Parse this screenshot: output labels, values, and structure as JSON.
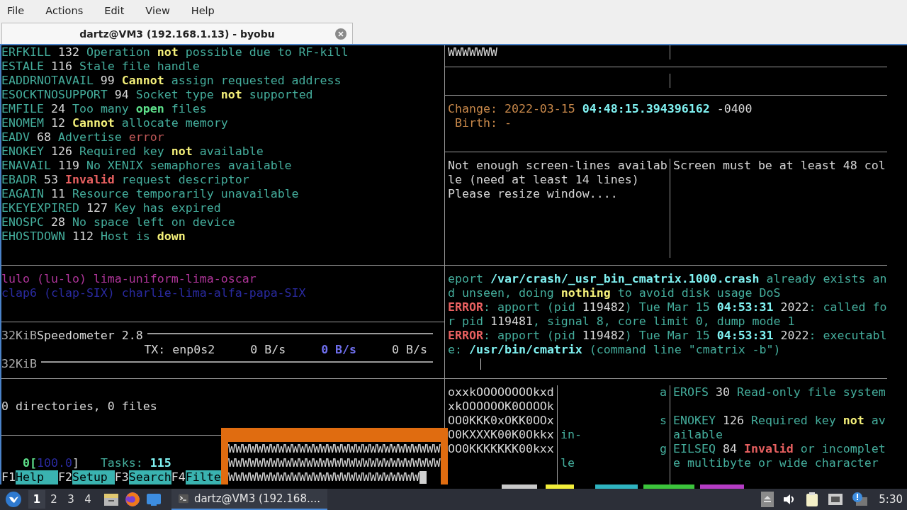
{
  "menu": [
    "File",
    "Actions",
    "Edit",
    "View",
    "Help"
  ],
  "tab": {
    "title": "dartz@VM3 (192.168.1.13) - byobu"
  },
  "errno_pane": [
    [
      {
        "text": "ERFKILL",
        "kind": "teal"
      },
      {
        "text": " 132 ",
        "kind": "light"
      },
      {
        "text": "Operation ",
        "kind": "teal"
      },
      {
        "text": "not",
        "kind": "yellow"
      },
      {
        "text": " possible due to RF-kill",
        "kind": "teal"
      }
    ],
    [
      {
        "text": "ESTALE",
        "kind": "teal"
      },
      {
        "text": " 116 ",
        "kind": "light"
      },
      {
        "text": "Stale file handle",
        "kind": "teal"
      }
    ],
    [
      {
        "text": "EADDRNOTAVAIL",
        "kind": "teal"
      },
      {
        "text": " 99 ",
        "kind": "light"
      },
      {
        "text": "Cannot",
        "kind": "yellow"
      },
      {
        "text": " assign requested address",
        "kind": "teal"
      }
    ],
    [
      {
        "text": "ESOCKTNOSUPPORT",
        "kind": "teal"
      },
      {
        "text": " 94 ",
        "kind": "light"
      },
      {
        "text": "Socket type ",
        "kind": "teal"
      },
      {
        "text": "not",
        "kind": "yellow"
      },
      {
        "text": " supported",
        "kind": "teal"
      }
    ],
    [
      {
        "text": "EMFILE",
        "kind": "teal"
      },
      {
        "text": " 24 ",
        "kind": "light"
      },
      {
        "text": "Too many ",
        "kind": "teal"
      },
      {
        "text": "open",
        "kind": "green"
      },
      {
        "text": " files",
        "kind": "teal"
      }
    ],
    [
      {
        "text": "ENOMEM",
        "kind": "teal"
      },
      {
        "text": " 12 ",
        "kind": "light"
      },
      {
        "text": "Cannot",
        "kind": "yellow"
      },
      {
        "text": " allocate memory",
        "kind": "teal"
      }
    ],
    [
      {
        "text": "EADV",
        "kind": "teal"
      },
      {
        "text": " 68 ",
        "kind": "light"
      },
      {
        "text": "Advertise ",
        "kind": "teal"
      },
      {
        "text": "error",
        "kind": "rose"
      }
    ],
    [
      {
        "text": "ENOKEY",
        "kind": "teal"
      },
      {
        "text": " 126 ",
        "kind": "light"
      },
      {
        "text": "Required key ",
        "kind": "teal"
      },
      {
        "text": "not",
        "kind": "yellow"
      },
      {
        "text": " available",
        "kind": "teal"
      }
    ],
    [
      {
        "text": "ENAVAIL",
        "kind": "teal"
      },
      {
        "text": " 119 ",
        "kind": "light"
      },
      {
        "text": "No XENIX semaphores available",
        "kind": "teal"
      }
    ],
    [
      {
        "text": "EBADR",
        "kind": "teal"
      },
      {
        "text": " 53 ",
        "kind": "light"
      },
      {
        "text": "Invalid",
        "kind": "red"
      },
      {
        "text": " request descriptor",
        "kind": "teal"
      }
    ],
    [
      {
        "text": "EAGAIN",
        "kind": "teal"
      },
      {
        "text": " 11 ",
        "kind": "light"
      },
      {
        "text": "Resource temporarily unavailable",
        "kind": "teal"
      }
    ],
    [
      {
        "text": "EKEYEXPIRED",
        "kind": "teal"
      },
      {
        "text": " 127 ",
        "kind": "light"
      },
      {
        "text": "Key has expired",
        "kind": "teal"
      }
    ],
    [
      {
        "text": "ENOSPC",
        "kind": "teal"
      },
      {
        "text": " 28 ",
        "kind": "light"
      },
      {
        "text": "No space left on device",
        "kind": "teal"
      }
    ],
    [
      {
        "text": "EHOSTDOWN",
        "kind": "teal"
      },
      {
        "text": " 112 ",
        "kind": "light"
      },
      {
        "text": "Host is ",
        "kind": "teal"
      },
      {
        "text": "down",
        "kind": "yellow"
      }
    ]
  ],
  "alphabet_pane": [
    [
      {
        "text": "lulo (lu-lo) lima-uniform-lima-oscar",
        "kind": "magenta"
      }
    ],
    [
      {
        "text": "clap6 (clap-SIX) charlie-lima-alfa-papa-SIX",
        "kind": "navy"
      }
    ]
  ],
  "speedometer": {
    "title": [
      {
        "text": "32KiB",
        "kind": "grey"
      },
      {
        "text": "Speedometer 2.8",
        "kind": "light"
      }
    ],
    "tx": [
      {
        "text": "TX: enp0s2     0 B/s     ",
        "kind": "light"
      },
      {
        "text": "0 B/s",
        "kind": "bluebold"
      },
      {
        "text": "     0 B/s",
        "kind": "light"
      }
    ],
    "scale": [
      {
        "text": "32KiB",
        "kind": "grey"
      }
    ]
  },
  "tree_pane": [
    [
      {
        "text": "0 directories, 0 files",
        "kind": "light"
      }
    ]
  ],
  "htop": {
    "meter": [
      {
        "text": "   0[",
        "kind": "green"
      },
      {
        "text": "100.0",
        "kind": "navy"
      },
      {
        "text": "]",
        "kind": "light"
      },
      {
        "text": "   Tasks: ",
        "kind": "teal"
      },
      {
        "text": "115",
        "kind": "cyan"
      }
    ],
    "keys": [
      {
        "key": "F1",
        "label": "Help"
      },
      {
        "key": "F2",
        "label": "Setup"
      },
      {
        "key": "F3",
        "label": "Search"
      },
      {
        "key": "F4",
        "label": "Filte"
      }
    ]
  },
  "popup": {
    "lines": [
      "WWWWWWWWWWWWWWWWWWWWWWWWWWWWWW",
      "WWWWWWWWWWWWWWWWWWWWWWWWWWWWWW",
      "WWWWWWWWWWWWWWWWWWWWWWWWWWW"
    ]
  },
  "top_right": {
    "cell": "WWWWWWW"
  },
  "stat_pane": [
    [
      {
        "text": "Change: 2022-03-15 ",
        "kind": "orange"
      },
      {
        "text": "04:48:15.394396162",
        "kind": "cyan"
      },
      {
        "text": " -0400",
        "kind": "light"
      }
    ],
    [
      {
        "text": " Birth: -",
        "kind": "orange"
      }
    ]
  ],
  "resize_left": [
    "Not enough screen-lines availab",
    "le (need at least 14 lines)",
    "Please resize window...."
  ],
  "resize_right": [
    "Screen must be at least 48 col"
  ],
  "apport_pane": [
    [
      {
        "text": "eport ",
        "kind": "teal"
      },
      {
        "text": "/var/crash/_usr_bin_cmatrix.1000.crash",
        "kind": "cyan"
      },
      {
        "text": " already exists an",
        "kind": "teal"
      }
    ],
    [
      {
        "text": "d unseen, doing ",
        "kind": "teal"
      },
      {
        "text": "nothing",
        "kind": "yellow"
      },
      {
        "text": " to avoid disk usage DoS",
        "kind": "teal"
      }
    ],
    [
      {
        "text": "ERROR",
        "kind": "red"
      },
      {
        "text": ": apport (pid ",
        "kind": "teal"
      },
      {
        "text": "119482",
        "kind": "light"
      },
      {
        "text": ") Tue Mar 15 ",
        "kind": "teal"
      },
      {
        "text": "04:53:31",
        "kind": "cyan"
      },
      {
        "text": " 2022",
        "kind": "light"
      },
      {
        "text": ": called fo",
        "kind": "teal"
      }
    ],
    [
      {
        "text": "r pid ",
        "kind": "teal"
      },
      {
        "text": "119481",
        "kind": "light"
      },
      {
        "text": ", signal 8, core limit 0, dump mode 1",
        "kind": "teal"
      }
    ],
    [
      {
        "text": "ERROR",
        "kind": "red"
      },
      {
        "text": ": apport (pid ",
        "kind": "teal"
      },
      {
        "text": "119482",
        "kind": "light"
      },
      {
        "text": ") Tue Mar 15 ",
        "kind": "teal"
      },
      {
        "text": "04:53:31",
        "kind": "cyan"
      },
      {
        "text": " 2022",
        "kind": "light"
      },
      {
        "text": ": executabl",
        "kind": "teal"
      }
    ],
    [
      {
        "text": "e: ",
        "kind": "teal"
      },
      {
        "text": "/usr/bin/cmatrix",
        "kind": "cyan"
      },
      {
        "text": " (command line \"cmatrix -b\")",
        "kind": "teal"
      }
    ]
  ],
  "bottom_rows": [
    {
      "logo": "oxxkOOOOOOOOkxd",
      "mid": {
        "text": "a",
        "kind": "right"
      },
      "errno": [
        {
          "text": "EROFS",
          "kind": "teal"
        },
        {
          "text": " 30 ",
          "kind": "light"
        },
        {
          "text": "Read-only file system",
          "kind": "teal"
        }
      ]
    },
    {
      "logo": "xkOOOOOOK0OOOOk"
    },
    {
      "logo": "OO0KKK0xOKK0OOx",
      "mid": {
        "text": "s",
        "kind": "right"
      },
      "errno": [
        {
          "text": "ENOKEY",
          "kind": "teal"
        },
        {
          "text": " 126 ",
          "kind": "light"
        },
        {
          "text": "Required key ",
          "kind": "teal"
        },
        {
          "text": "not",
          "kind": "yellow"
        },
        {
          "text": " av",
          "kind": "teal"
        }
      ]
    },
    {
      "logo": "O0KXXXK00K0Okkx",
      "mid": {
        "text": "in-",
        "kind": "left"
      },
      "errno": [
        {
          "text": "ailable",
          "kind": "teal"
        }
      ]
    },
    {
      "logo": "OO0KKKKKKK00kxx",
      "mid": {
        "text": "g",
        "kind": "right"
      },
      "errno": [
        {
          "text": "EILSEQ",
          "kind": "teal"
        },
        {
          "text": " 84 ",
          "kind": "light"
        },
        {
          "text": "Invalid",
          "kind": "red"
        },
        {
          "text": " or incomplet",
          "kind": "teal"
        }
      ]
    },
    {
      "mid": {
        "text": "le",
        "kind": "left"
      },
      "errno": [
        {
          "text": "e multibyte or wide character",
          "kind": "teal"
        }
      ]
    }
  ],
  "taskbar": {
    "workspaces": [
      {
        "label": "1",
        "selected": true
      },
      {
        "label": "2",
        "selected": false
      },
      {
        "label": "3",
        "selected": false
      },
      {
        "label": "4",
        "selected": false
      }
    ],
    "task": {
      "title": "dartz@VM3 (192.168....",
      "selected": true
    },
    "clock": "5:30"
  }
}
